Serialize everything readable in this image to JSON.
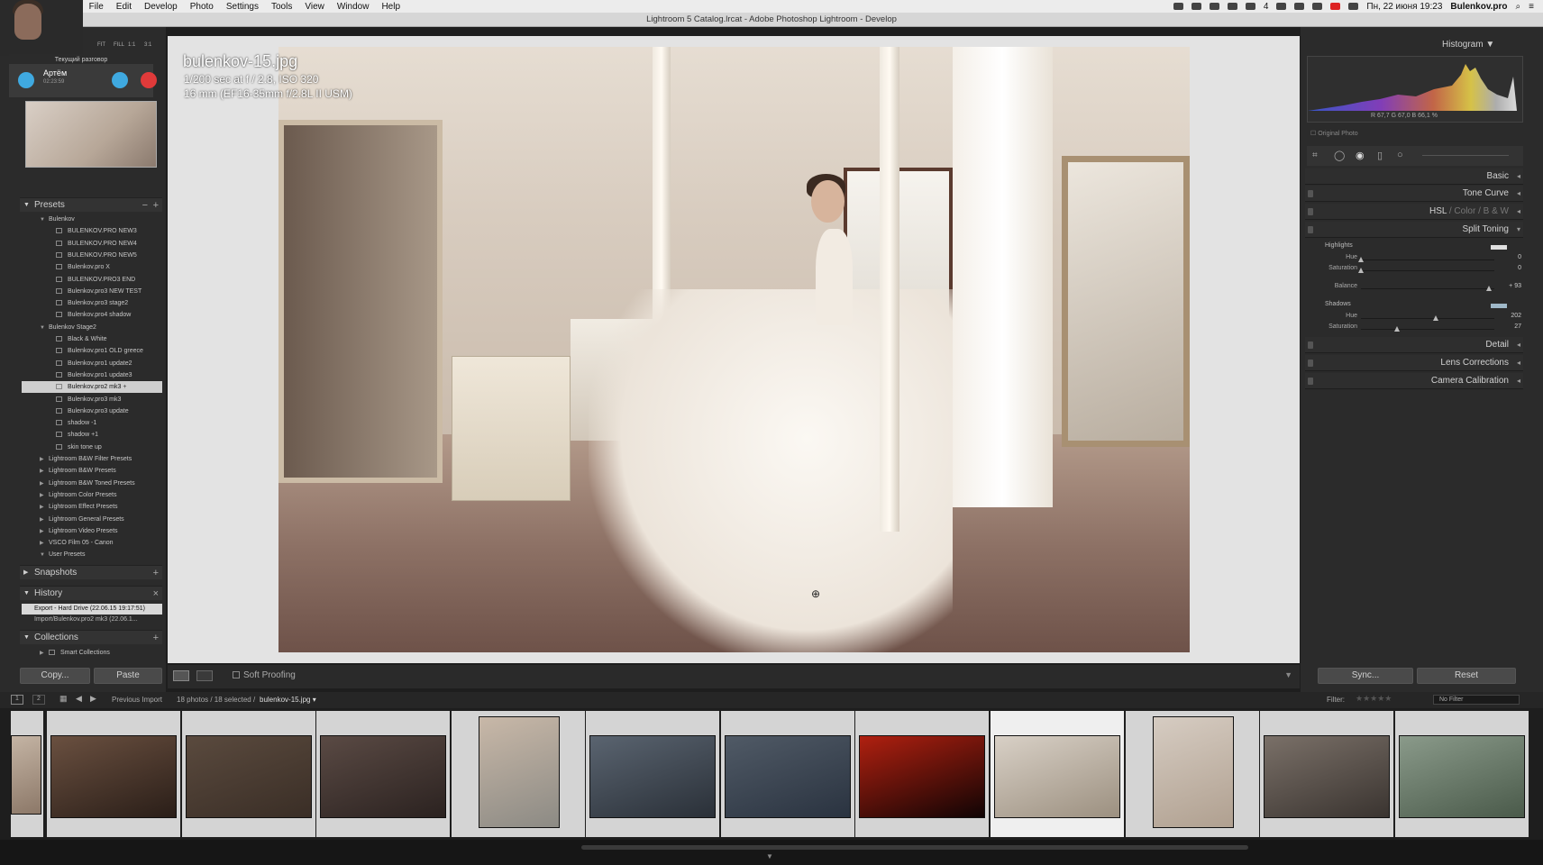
{
  "menubar": {
    "items": [
      "File",
      "Edit",
      "Develop",
      "Photo",
      "Settings",
      "Tools",
      "View",
      "Window",
      "Help"
    ],
    "right": {
      "battery": "4",
      "datetime": "Пн, 22 июня 19:23",
      "user": "Bulenkov.pro"
    }
  },
  "titlebar": "Lightroom 5 Catalog.lrcat - Adobe Photoshop Lightroom - Develop",
  "skype": {
    "header": "Текущий разговор",
    "caller": "Артём",
    "duration": "02:23:59"
  },
  "navigator": {
    "controls": [
      "FIT",
      "FILL",
      "1:1",
      "3:1"
    ]
  },
  "presets": {
    "title": "Presets",
    "groups": [
      {
        "name": "Bulenkov",
        "items": [
          "BULENKOV.PRO NEW3",
          "BULENKOV.PRO NEW4",
          "BULENKOV.PRO NEW5",
          "Bulenkov.pro X",
          "BULENKOV.PRO3 END",
          "Bulenkov.pro3 NEW TEST",
          "Bulenkov.pro3 stage2",
          "Bulenkov.pro4 shadow"
        ]
      },
      {
        "name": "Bulenkov Stage2",
        "items": [
          "Black & White",
          "Bulenkov.pro1 OLD greece",
          "Bulenkov.pro1 update2",
          "Bulenkov.pro1 update3",
          "Bulenkov.pro2 mk3",
          "Bulenkov.pro3 mk3",
          "Bulenkov.pro3 update",
          "shadow -1",
          "shadow +1",
          "skin tone up"
        ],
        "selected": "Bulenkov.pro2 mk3"
      }
    ],
    "collapsed": [
      "Lightroom B&W Filter Presets",
      "Lightroom B&W Presets",
      "Lightroom B&W Toned Presets",
      "Lightroom Color Presets",
      "Lightroom Effect Presets",
      "Lightroom General Presets",
      "Lightroom Video Presets",
      "VSCO Film 05 - Canon",
      "User Presets"
    ]
  },
  "snapshots": {
    "title": "Snapshots"
  },
  "history": {
    "title": "History",
    "items": [
      "Export - Hard Drive (22.06.15 19:17:51)",
      "Import/Bulenkov.pro2 mk3 (22.06.1..."
    ]
  },
  "collections": {
    "title": "Collections",
    "items": [
      "Smart Collections"
    ]
  },
  "leftbuttons": {
    "copy": "Copy...",
    "paste": "Paste"
  },
  "photoinfo": {
    "filename": "bulenkov-15.jpg",
    "exposure": "1/200 sec at f / 2.8, ISO 320",
    "lens": "16 mm (EF16-35mm f/2.8L II USM)"
  },
  "toolbar": {
    "softproof": "Soft Proofing"
  },
  "histogram": {
    "title": "Histogram",
    "readout": "R 67,7  G 67,0  B 66,1 %",
    "original": "Original Photo"
  },
  "panels": {
    "basic": "Basic",
    "tone": "Tone Curve",
    "hsl": "HSL",
    "color": "Color",
    "bw": "B & W",
    "split": "Split Toning",
    "detail": "Detail",
    "lens": "Lens Corrections",
    "calib": "Camera Calibration"
  },
  "split": {
    "highlights": "Highlights",
    "shadows": "Shadows",
    "rows": [
      {
        "label": "Hue",
        "value": "0",
        "pos": 0.0
      },
      {
        "label": "Saturation",
        "value": "0",
        "pos": 0.0
      },
      {
        "label": "Balance",
        "value": "+ 93",
        "pos": 0.96
      },
      {
        "label": "Hue",
        "value": "202",
        "pos": 0.56
      },
      {
        "label": "Saturation",
        "value": "27",
        "pos": 0.27
      }
    ]
  },
  "rightbuttons": {
    "sync": "Sync...",
    "reset": "Reset"
  },
  "filmbar": {
    "source": "Previous Import",
    "count": "18 photos / 18 selected /",
    "file": "bulenkov-15.jpg",
    "filter": "Filter:",
    "nofilter": "No Filter"
  },
  "colors": {
    "accent": "#cfcfcf",
    "panel": "#2b2b2b"
  }
}
